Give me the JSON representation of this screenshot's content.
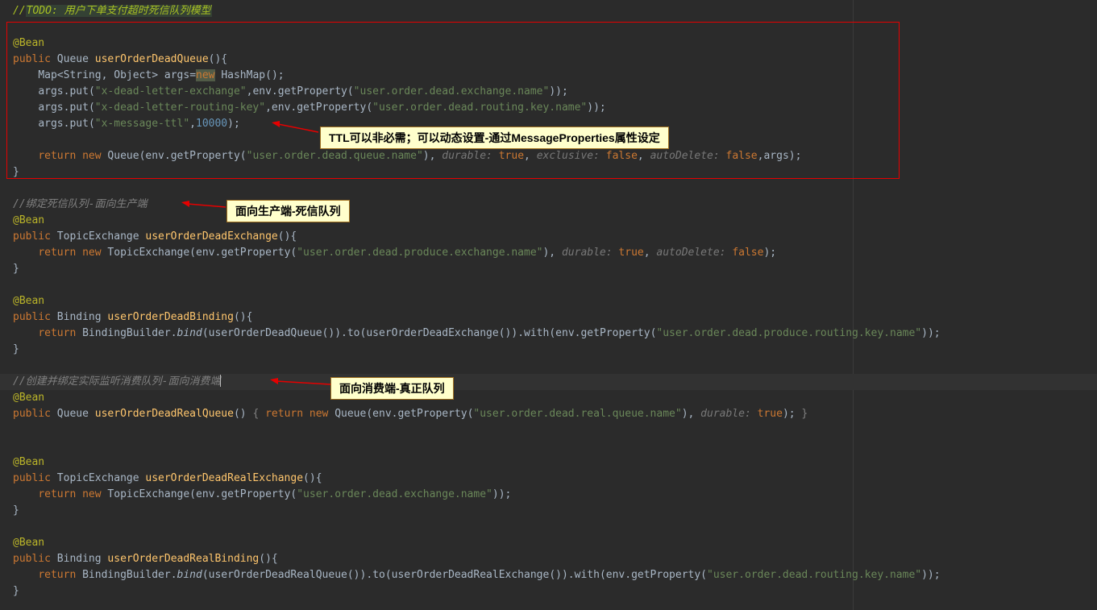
{
  "code": {
    "comment_todo_prefix": "//",
    "comment_todo": "TODO: 用户下单支付超时死信队列模型",
    "bean": "@Bean",
    "kw_public": "public",
    "kw_return": "return",
    "kw_new": "new",
    "type_Queue": "Queue",
    "type_Map": "Map",
    "type_String": "String",
    "type_Object": "Object",
    "type_HashMap": "HashMap",
    "type_TopicExchange": "TopicExchange",
    "type_Binding": "Binding",
    "type_BindingBuilder": "BindingBuilder",
    "m_userOrderDeadQueue": "userOrderDeadQueue",
    "m_userOrderDeadExchange": "userOrderDeadExchange",
    "m_userOrderDeadBinding": "userOrderDeadBinding",
    "m_userOrderDeadRealQueue": "userOrderDeadRealQueue",
    "m_userOrderDeadRealExchange": "userOrderDeadRealExchange",
    "m_userOrderDeadRealBinding": "userOrderDeadRealBinding",
    "var_args": "args",
    "var_env": "env",
    "m_put": "put",
    "m_getProperty": "getProperty",
    "m_bind": "bind",
    "m_to": "to",
    "m_with": "with",
    "s_dle": "\"x-dead-letter-exchange\"",
    "s_dlrk": "\"x-dead-letter-routing-key\"",
    "s_ttl": "\"x-message-ttl\"",
    "s_dead_exchange": "\"user.order.dead.exchange.name\"",
    "s_dead_routing_key": "\"user.order.dead.routing.key.name\"",
    "s_dead_queue": "\"user.order.dead.queue.name\"",
    "s_dead_produce_exchange": "\"user.order.dead.produce.exchange.name\"",
    "s_dead_produce_routing_key": "\"user.order.dead.produce.routing.key.name\"",
    "s_dead_real_queue": "\"user.order.dead.real.queue.name\"",
    "n_10000": "10000",
    "hint_durable": "durable: ",
    "hint_exclusive": "exclusive: ",
    "hint_autoDelete": "autoDelete: ",
    "val_true": "true",
    "val_false": "false",
    "comment_produce": "//绑定死信队列-面向生产端",
    "comment_consume": "//创建并绑定实际监听消费队列-面向消费端"
  },
  "callouts": {
    "ttl": "TTL可以非必需；可以动态设置-通过MessageProperties属性设定",
    "produce": "面向生产端-死信队列",
    "consume": "面向消费端-真正队列"
  }
}
